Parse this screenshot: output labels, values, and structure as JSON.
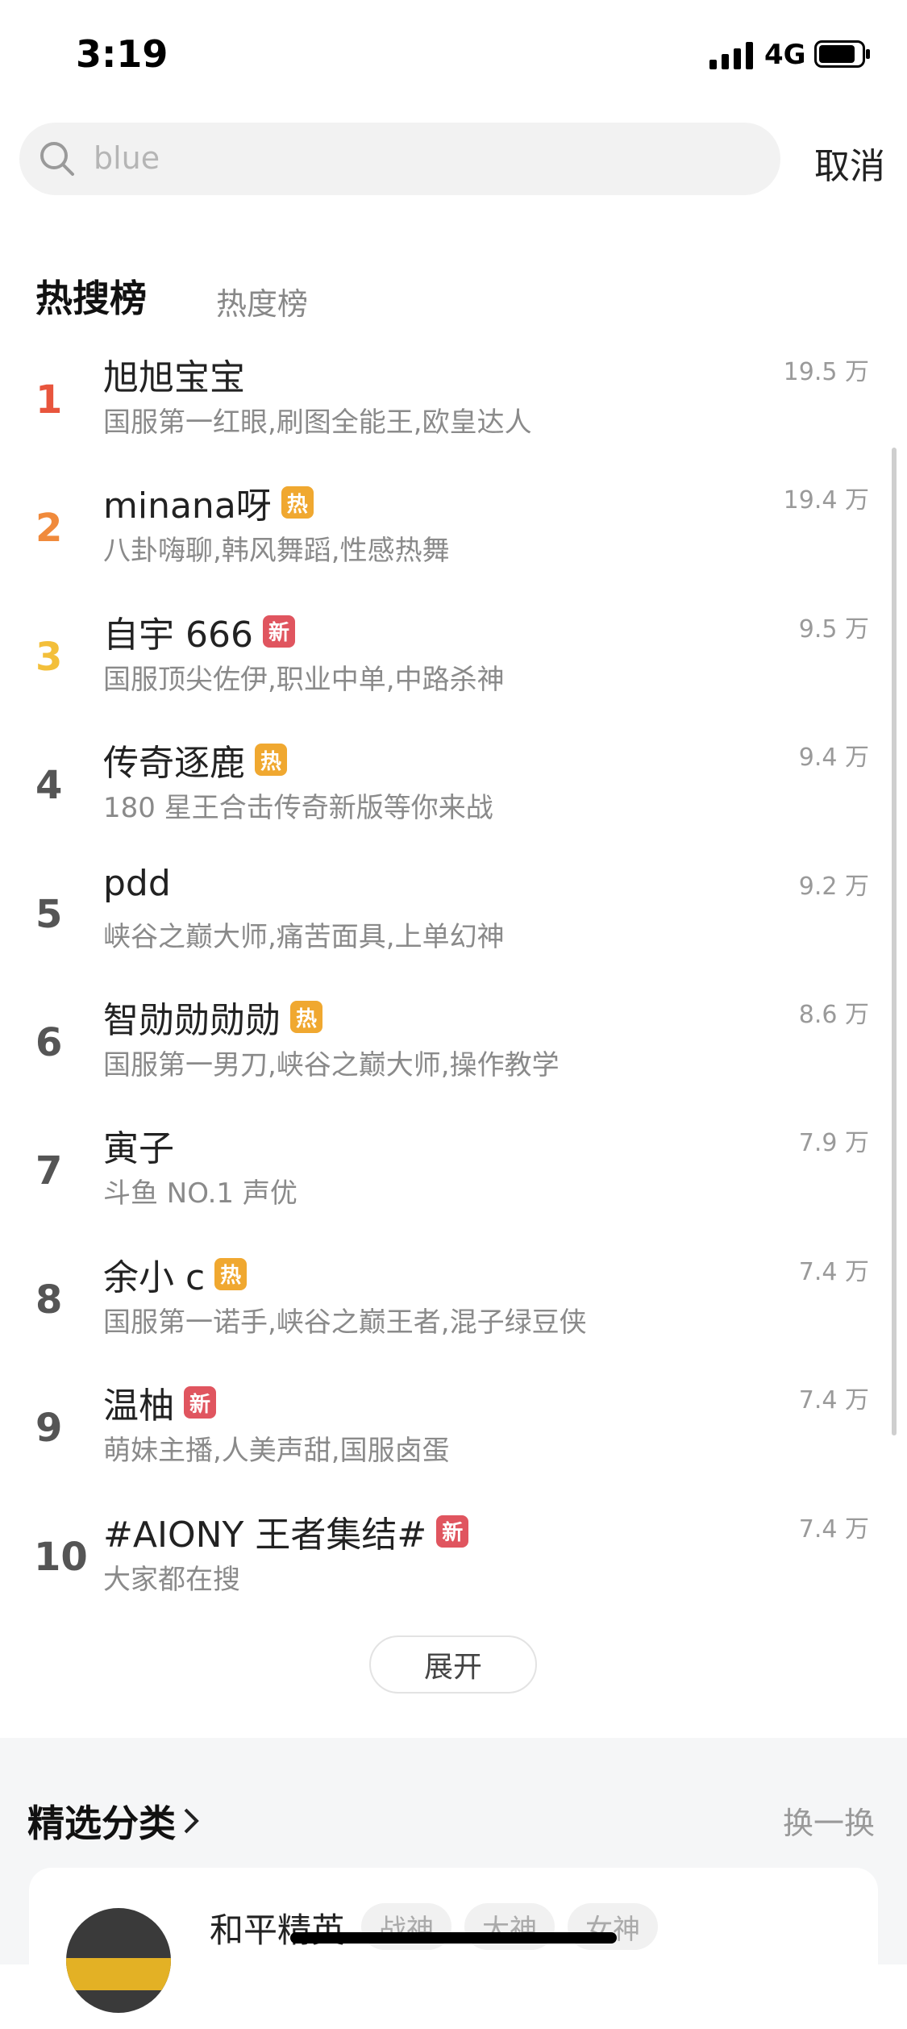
{
  "status": {
    "time": "3:19",
    "network": "4G"
  },
  "search": {
    "query": "blue",
    "cancel_label": "取消"
  },
  "tabs": {
    "active": "热搜榜",
    "inactive": "热度榜"
  },
  "badges": {
    "hot": "热",
    "new": "新"
  },
  "colors": {
    "rank1": "#e8553d",
    "rank2": "#f08a3c",
    "rank3": "#f3bf3a",
    "rank_default": "#555555",
    "hot_badge": "#f0a830",
    "new_badge": "#e0555f"
  },
  "items": [
    {
      "rank": "1",
      "title": "旭旭宝宝",
      "badge": "",
      "desc": "国服第一红眼,刷图全能王,欧皇达人",
      "score": "19.5 万"
    },
    {
      "rank": "2",
      "title": "minana呀",
      "badge": "hot",
      "desc": "八卦嗨聊,韩风舞蹈,性感热舞",
      "score": "19.4 万"
    },
    {
      "rank": "3",
      "title": "自宇 666",
      "badge": "new",
      "desc": "国服顶尖佐伊,职业中单,中路杀神",
      "score": "9.5 万"
    },
    {
      "rank": "4",
      "title": "传奇逐鹿",
      "badge": "hot",
      "desc": "180 星王合击传奇新版等你来战",
      "score": "9.4 万"
    },
    {
      "rank": "5",
      "title": "pdd",
      "badge": "",
      "desc": "峡谷之巅大师,痛苦面具,上单幻神",
      "score": "9.2 万"
    },
    {
      "rank": "6",
      "title": "智勋勋勋勋",
      "badge": "hot",
      "desc": "国服第一男刀,峡谷之巅大师,操作教学",
      "score": "8.6 万"
    },
    {
      "rank": "7",
      "title": "寅子",
      "badge": "",
      "desc": "斗鱼 NO.1 声优",
      "score": "7.9 万"
    },
    {
      "rank": "8",
      "title": "余小 c",
      "badge": "hot",
      "desc": "国服第一诺手,峡谷之巅王者,混子绿豆侠",
      "score": "7.4 万"
    },
    {
      "rank": "9",
      "title": "温柚",
      "badge": "new",
      "desc": "萌妹主播,人美声甜,国服卤蛋",
      "score": "7.4 万"
    },
    {
      "rank": "10",
      "title": "#AIONY 王者集结#",
      "badge": "new",
      "desc": "大家都在搜",
      "score": "7.4 万"
    }
  ],
  "expand_label": "展开",
  "featured": {
    "title": "精选分类",
    "refresh_label": "换一换",
    "card": {
      "name": "和平精英",
      "tags": [
        "战神",
        "大神",
        "女神"
      ]
    }
  }
}
